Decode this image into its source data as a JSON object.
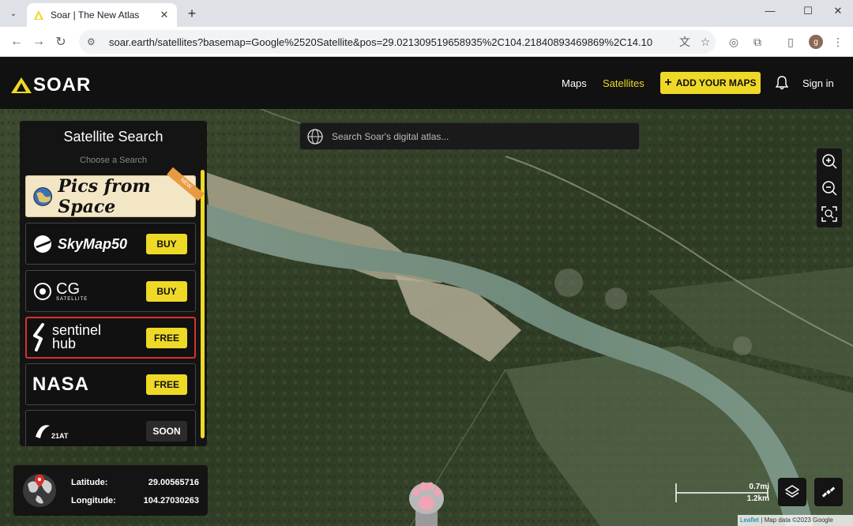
{
  "browser": {
    "tab_title": "Soar | The New Atlas",
    "url": "soar.earth/satellites?basemap=Google%2520Satellite&pos=29.021309519658935%2C104.21840893469869%2C14.10",
    "profile_initial": "g"
  },
  "header": {
    "logo_text": "SOAR",
    "nav": [
      {
        "label": "Maps",
        "active": false
      },
      {
        "label": "Satellites",
        "active": true
      }
    ],
    "add_maps_label": "ADD YOUR MAPS",
    "signin_label": "Sign in",
    "accent_color": "#eed926"
  },
  "map_search": {
    "placeholder": "Search Soar's digital atlas..."
  },
  "satellite_panel": {
    "title": "Satellite Search",
    "subtitle": "Choose a Search",
    "providers": [
      {
        "name": "Pics from Space",
        "badge": "NEW",
        "button": null
      },
      {
        "name": "SkyMap50",
        "button": "BUY"
      },
      {
        "name": "CG",
        "subname": "SATELLITE",
        "button": "BUY"
      },
      {
        "name": "sentinel",
        "subname": "hub",
        "button": "FREE",
        "selected": true
      },
      {
        "name": "NASA",
        "button": "FREE"
      },
      {
        "name": "21AT",
        "button": "SOON"
      }
    ]
  },
  "coordinates": {
    "latitude_label": "Latitude:",
    "latitude": "29.00565716",
    "longitude_label": "Longitude:",
    "longitude": "104.27030263"
  },
  "scale": {
    "metric": "0.7mi",
    "imperial": "1.2km"
  },
  "attribution": {
    "leaflet": "Leaflet",
    "text": "| Map data ©2023 Google"
  }
}
